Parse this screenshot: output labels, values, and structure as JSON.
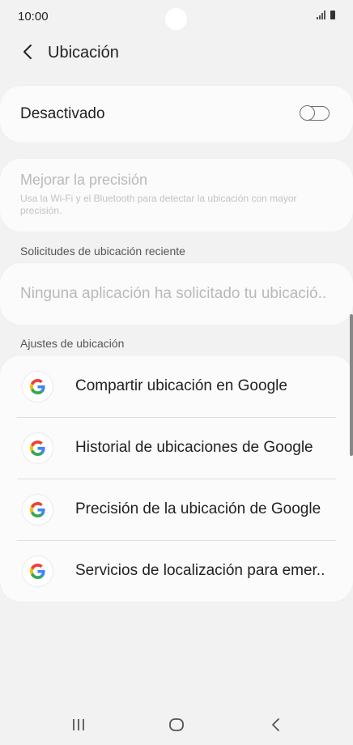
{
  "status_bar": {
    "time": "10:00"
  },
  "header": {
    "title": "Ubicación",
    "back_icon": "chevron-left-icon"
  },
  "location_toggle": {
    "label": "Desactivado",
    "enabled": false
  },
  "precision": {
    "title": "Mejorar la precisión",
    "description": "Usa la Wi-Fi y el Bluetooth para detectar la ubicación con mayor precisión."
  },
  "recent_requests": {
    "header": "Solicitudes de ubicación reciente",
    "empty_text": "Ninguna aplicación ha solicitado tu ubicació.."
  },
  "settings": {
    "header": "Ajustes de ubicación",
    "items": [
      {
        "label": "Compartir ubicación en Google",
        "icon": "google-icon"
      },
      {
        "label": "Historial de ubicaciones de Google",
        "icon": "google-icon"
      },
      {
        "label": "Precisión de la ubicación de Google",
        "icon": "google-icon"
      },
      {
        "label": "Servicios de localización para emer..",
        "icon": "google-icon"
      }
    ]
  },
  "colors": {
    "background": "#f2f2f2",
    "card": "#fbfbfb",
    "disabled_text": "#b9b9b9",
    "google_blue": "#4285F4",
    "google_red": "#EA4335",
    "google_yellow": "#FBBC05",
    "google_green": "#34A853"
  }
}
